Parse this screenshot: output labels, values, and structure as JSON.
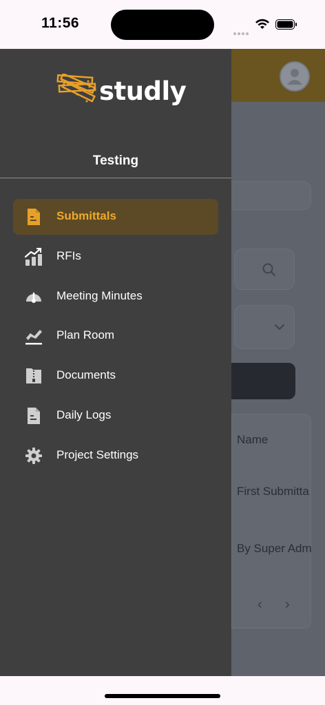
{
  "status_bar": {
    "time": "11:56",
    "icons": [
      "signal-dots-icon",
      "wifi-icon",
      "battery-icon"
    ]
  },
  "drawer": {
    "logo_text": "studly",
    "project_name": "Testing",
    "menu": [
      {
        "label": "Submittals",
        "icon": "submittals-document-icon",
        "active": true
      },
      {
        "label": "RFIs",
        "icon": "rfi-chart-icon",
        "active": false
      },
      {
        "label": "Meeting Minutes",
        "icon": "gauge-icon",
        "active": false
      },
      {
        "label": "Plan Room",
        "icon": "plan-room-icon",
        "active": false
      },
      {
        "label": "Documents",
        "icon": "zip-folder-icon",
        "active": false
      },
      {
        "label": "Daily Logs",
        "icon": "daily-log-document-icon",
        "active": false
      },
      {
        "label": "Project Settings",
        "icon": "gear-icon",
        "active": false
      }
    ]
  },
  "background": {
    "column_header": "Name",
    "row_title": "First Submitta",
    "row_author": "By Super Adm",
    "pager_prev": "‹",
    "pager_next": "›"
  },
  "colors": {
    "drawer_bg": "#3f3f3f",
    "accent": "#f0a92a",
    "active_item_bg": "#5c4a26",
    "overlay_bg": "#5e636c"
  }
}
